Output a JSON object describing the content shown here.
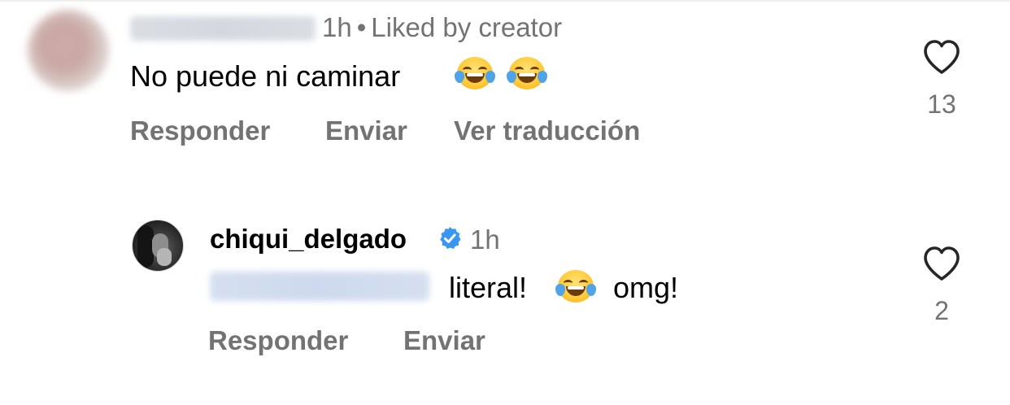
{
  "comments": [
    {
      "username": "",
      "time": "1h",
      "liked_by": "Liked by creator",
      "text": "No puede ni caminar",
      "emojis": [
        "face-with-tears-of-joy",
        "face-with-tears-of-joy"
      ],
      "actions": {
        "reply": "Responder",
        "send": "Enviar",
        "translate": "Ver traducción"
      },
      "likes": "13"
    },
    {
      "username": "chiqui_delgado",
      "verified": true,
      "time": "1h",
      "mention": "",
      "text_before": "literal!",
      "emoji": "face-with-tears-of-joy",
      "text_after": "omg!",
      "actions": {
        "reply": "Responder",
        "send": "Enviar"
      },
      "likes": "2"
    }
  ],
  "colors": {
    "secondary_text": "#737373",
    "primary_text": "#000000",
    "verified_badge": "#3897f0",
    "background": "#ffffff"
  },
  "icons": [
    "heart-outline-icon",
    "verified-badge-icon"
  ]
}
